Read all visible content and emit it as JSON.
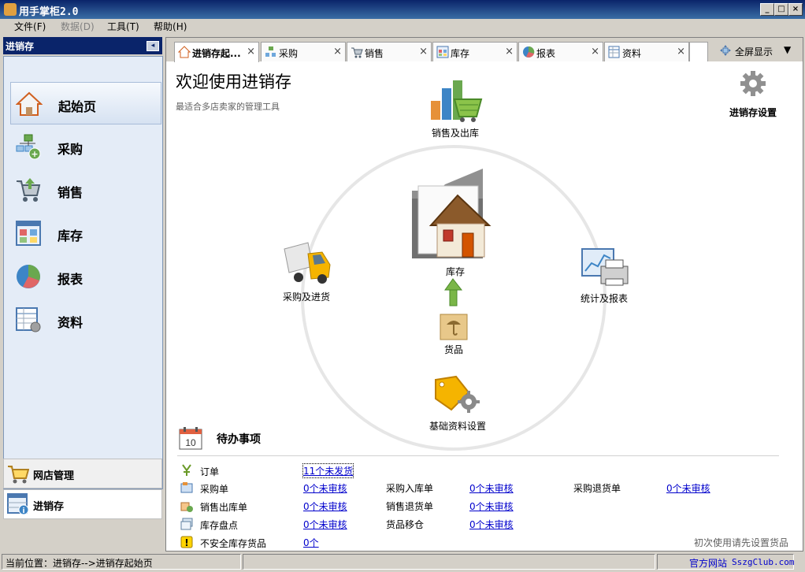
{
  "window": {
    "title": "用手掌柜2.0"
  },
  "menu": [
    {
      "label": "文件",
      "key": "(F)",
      "enabled": true
    },
    {
      "label": "数据",
      "key": "(D)",
      "enabled": false
    },
    {
      "label": "工具",
      "key": "(T)",
      "enabled": true
    },
    {
      "label": "帮助",
      "key": "(H)",
      "enabled": true
    }
  ],
  "sidebar": {
    "title": "进销存",
    "items": [
      {
        "label": "起始页",
        "icon": "home-icon",
        "active": true
      },
      {
        "label": "采购",
        "icon": "purchase-icon"
      },
      {
        "label": "销售",
        "icon": "cart-icon"
      },
      {
        "label": "库存",
        "icon": "inventory-icon"
      },
      {
        "label": "报表",
        "icon": "pie-chart-icon"
      },
      {
        "label": "资料",
        "icon": "data-table-icon"
      }
    ],
    "bottom": [
      {
        "label": "网店管理",
        "icon": "shop-cart-icon"
      },
      {
        "label": "进销存",
        "icon": "inventory-info-icon"
      }
    ]
  },
  "tabs": [
    {
      "label": "进销存起...",
      "active": true
    },
    {
      "label": "采购"
    },
    {
      "label": "销售"
    },
    {
      "label": "库存"
    },
    {
      "label": "报表"
    },
    {
      "label": "资料"
    }
  ],
  "fullscreen_label": "全屏显示",
  "welcome": {
    "title": "欢迎使用进销存",
    "subtitle": "最适合多店卖家的管理工具"
  },
  "settings_label": "进销存设置",
  "diagram": {
    "sales": "销售及出库",
    "purchase": "采购及进货",
    "stats": "统计及报表",
    "center": "库存",
    "goods": "货品",
    "base": "基础资料设置"
  },
  "todo": {
    "title": "待办事项",
    "calendar_day": "10",
    "rows": [
      [
        {
          "label": "订单",
          "value": "11个未发货"
        }
      ],
      [
        {
          "label": "采购单",
          "value": "0个未审核"
        },
        {
          "label": "采购入库单",
          "value": "0个未审核"
        },
        {
          "label": "采购退货单",
          "value": "0个未审核"
        }
      ],
      [
        {
          "label": "销售出库单",
          "value": "0个未审核"
        },
        {
          "label": "销售退货单",
          "value": "0个未审核"
        }
      ],
      [
        {
          "label": "库存盘点",
          "value": "0个未审核"
        },
        {
          "label": "货品移仓",
          "value": "0个未审核"
        }
      ],
      [
        {
          "label": "不安全库存货品",
          "value": "0个"
        }
      ]
    ],
    "hint": "初次使用请先设置货品"
  },
  "status": {
    "location": "当前位置：进销存-->进销存起始页",
    "site_label": "官方网站",
    "site_url": "SszgClub.com"
  }
}
